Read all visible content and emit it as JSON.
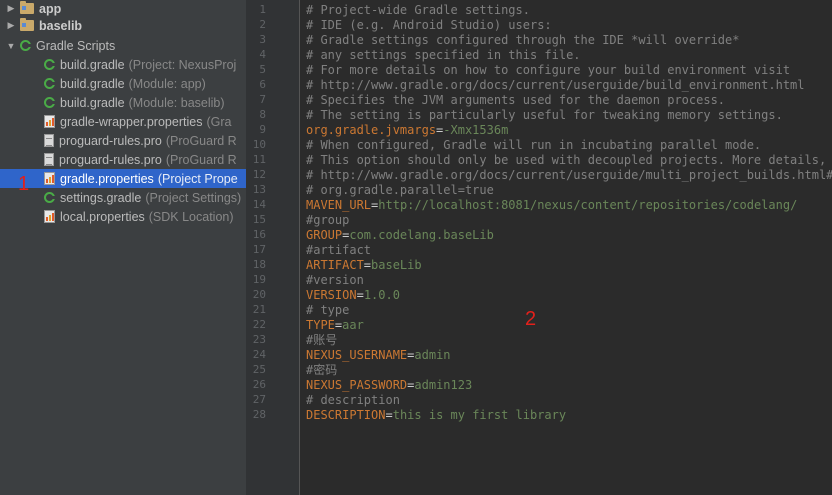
{
  "sidebar": {
    "items": [
      {
        "label": "app",
        "hint": "",
        "icon": "folder-icon",
        "arrow": "▶",
        "indent": 6,
        "bold": true
      },
      {
        "label": "baselib",
        "hint": "",
        "icon": "folder-icon",
        "arrow": "▶",
        "indent": 6,
        "bold": true
      },
      {
        "label": "Gradle Scripts",
        "hint": "",
        "icon": "gradle-icon",
        "arrow": "▼",
        "indent": 6,
        "bold": false
      },
      {
        "label": "build.gradle",
        "hint": "(Project: NexusProj",
        "icon": "gradle-icon",
        "arrow": "",
        "indent": 44,
        "bold": false
      },
      {
        "label": "build.gradle",
        "hint": "(Module: app)",
        "icon": "gradle-icon",
        "arrow": "",
        "indent": 44,
        "bold": false
      },
      {
        "label": "build.gradle",
        "hint": "(Module: baselib)",
        "icon": "gradle-icon",
        "arrow": "",
        "indent": 44,
        "bold": false
      },
      {
        "label": "gradle-wrapper.properties",
        "hint": "(Gra",
        "icon": "properties-icon",
        "arrow": "",
        "indent": 44,
        "bold": false
      },
      {
        "label": "proguard-rules.pro",
        "hint": "(ProGuard R",
        "icon": "file-icon",
        "arrow": "",
        "indent": 44,
        "bold": false
      },
      {
        "label": "proguard-rules.pro",
        "hint": "(ProGuard R",
        "icon": "file-icon",
        "arrow": "",
        "indent": 44,
        "bold": false
      },
      {
        "label": "gradle.properties",
        "hint": "(Project Prope",
        "icon": "properties-icon",
        "arrow": "",
        "indent": 44,
        "bold": false,
        "selected": true
      },
      {
        "label": "settings.gradle",
        "hint": "(Project Settings)",
        "icon": "gradle-icon",
        "arrow": "",
        "indent": 44,
        "bold": false
      },
      {
        "label": "local.properties",
        "hint": "(SDK Location)",
        "icon": "properties-icon",
        "arrow": "",
        "indent": 44,
        "bold": false
      }
    ]
  },
  "annotations": {
    "left": "1",
    "right": "2"
  },
  "editor": {
    "lines": [
      {
        "n": "1",
        "parts": [
          {
            "t": "# Project-wide Gradle settings.",
            "c": "comment"
          }
        ]
      },
      {
        "n": "2",
        "parts": [
          {
            "t": "# IDE (e.g. Android Studio) users:",
            "c": "comment"
          }
        ]
      },
      {
        "n": "3",
        "parts": [
          {
            "t": "# Gradle settings configured through the IDE *will override*",
            "c": "comment"
          }
        ]
      },
      {
        "n": "4",
        "parts": [
          {
            "t": "# any settings specified in this file.",
            "c": "comment"
          }
        ]
      },
      {
        "n": "5",
        "parts": [
          {
            "t": "# For more details on how to configure your build environment visit",
            "c": "comment"
          }
        ]
      },
      {
        "n": "6",
        "parts": [
          {
            "t": "# http://www.gradle.org/docs/current/userguide/build_environment.html",
            "c": "comment"
          }
        ]
      },
      {
        "n": "7",
        "parts": [
          {
            "t": "# Specifies the JVM arguments used for the daemon process.",
            "c": "comment"
          }
        ]
      },
      {
        "n": "8",
        "parts": [
          {
            "t": "# The setting is particularly useful for tweaking memory settings.",
            "c": "comment"
          }
        ]
      },
      {
        "n": "9",
        "parts": [
          {
            "t": "org.gradle.jvmargs",
            "c": "key"
          },
          {
            "t": "=",
            "c": "eq"
          },
          {
            "t": "-Xmx1536m",
            "c": "val"
          }
        ]
      },
      {
        "n": "10",
        "parts": [
          {
            "t": "# When configured, Gradle will run in incubating parallel mode.",
            "c": "comment"
          }
        ]
      },
      {
        "n": "11",
        "parts": [
          {
            "t": "# This option should only be used with decoupled projects. More details, vi",
            "c": "comment"
          }
        ]
      },
      {
        "n": "12",
        "parts": [
          {
            "t": "# http://www.gradle.org/docs/current/userguide/multi_project_builds.html#se",
            "c": "comment"
          }
        ]
      },
      {
        "n": "13",
        "parts": [
          {
            "t": "# org.gradle.parallel=true",
            "c": "comment"
          }
        ]
      },
      {
        "n": "14",
        "parts": [
          {
            "t": "MAVEN_URL",
            "c": "key"
          },
          {
            "t": "=",
            "c": "eq"
          },
          {
            "t": "http://localhost:8081/nexus/content/repositories/codelang/",
            "c": "val"
          }
        ]
      },
      {
        "n": "15",
        "parts": [
          {
            "t": "#group",
            "c": "comment"
          }
        ]
      },
      {
        "n": "16",
        "parts": [
          {
            "t": "GROUP",
            "c": "key"
          },
          {
            "t": "=",
            "c": "eq"
          },
          {
            "t": "com.codelang.baseLib",
            "c": "val"
          }
        ]
      },
      {
        "n": "17",
        "parts": [
          {
            "t": "#artifact",
            "c": "comment"
          }
        ]
      },
      {
        "n": "18",
        "parts": [
          {
            "t": "ARTIFACT",
            "c": "key"
          },
          {
            "t": "=",
            "c": "eq"
          },
          {
            "t": "baseLib",
            "c": "val"
          }
        ]
      },
      {
        "n": "19",
        "parts": [
          {
            "t": "#version",
            "c": "comment"
          }
        ]
      },
      {
        "n": "20",
        "parts": [
          {
            "t": "VERSION",
            "c": "key"
          },
          {
            "t": "=",
            "c": "eq"
          },
          {
            "t": "1.0.0",
            "c": "val"
          }
        ]
      },
      {
        "n": "21",
        "parts": [
          {
            "t": "# type",
            "c": "comment"
          }
        ]
      },
      {
        "n": "22",
        "parts": [
          {
            "t": "TYPE",
            "c": "key"
          },
          {
            "t": "=",
            "c": "eq"
          },
          {
            "t": "aar",
            "c": "val"
          }
        ]
      },
      {
        "n": "23",
        "parts": [
          {
            "t": "#账号",
            "c": "comment"
          }
        ]
      },
      {
        "n": "24",
        "parts": [
          {
            "t": "NEXUS_USERNAME",
            "c": "key"
          },
          {
            "t": "=",
            "c": "eq"
          },
          {
            "t": "admin",
            "c": "val"
          }
        ]
      },
      {
        "n": "25",
        "parts": [
          {
            "t": "#密码",
            "c": "comment"
          }
        ]
      },
      {
        "n": "26",
        "parts": [
          {
            "t": "NEXUS_PASSWORD",
            "c": "key"
          },
          {
            "t": "=",
            "c": "eq"
          },
          {
            "t": "admin123",
            "c": "val"
          }
        ]
      },
      {
        "n": "27",
        "parts": [
          {
            "t": "# description",
            "c": "comment"
          }
        ]
      },
      {
        "n": "28",
        "parts": [
          {
            "t": "DESCRIPTION",
            "c": "key"
          },
          {
            "t": "=",
            "c": "eq"
          },
          {
            "t": "this is my first library",
            "c": "val"
          }
        ]
      }
    ]
  },
  "colors": {
    "comment": "#808080",
    "key": "#cc7832",
    "value": "#6a8759",
    "selection": "#2f65ca"
  }
}
